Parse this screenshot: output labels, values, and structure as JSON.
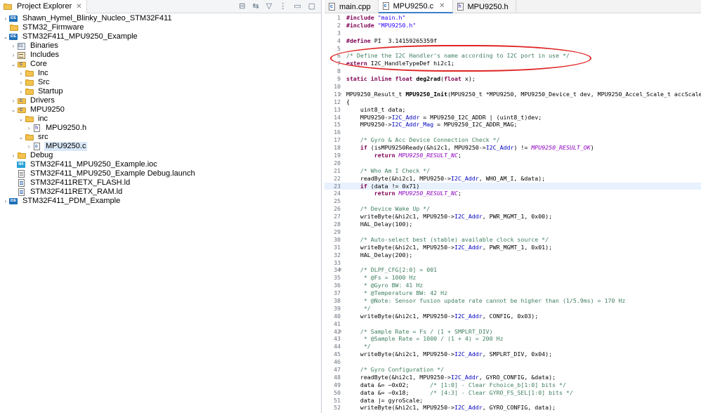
{
  "explorer": {
    "title": "Project Explorer",
    "tree": [
      {
        "label": "Shawn_Hymel_Blinky_Nucleo_STM32F411",
        "icon": "project-icon",
        "depth": 0,
        "caret": ">"
      },
      {
        "label": "STM32_Firmware",
        "icon": "folder-icon",
        "depth": 0,
        "caret": ""
      },
      {
        "label": "STM32F411_MPU9250_Example",
        "icon": "project-icon",
        "depth": 0,
        "caret": "v"
      },
      {
        "label": "Binaries",
        "icon": "binaries-icon",
        "depth": 1,
        "caret": ">"
      },
      {
        "label": "Includes",
        "icon": "includes-icon",
        "depth": 1,
        "caret": ">"
      },
      {
        "label": "Core",
        "icon": "source-folder-icon",
        "depth": 1,
        "caret": "v"
      },
      {
        "label": "Inc",
        "icon": "folder-icon",
        "depth": 2,
        "caret": ">"
      },
      {
        "label": "Src",
        "icon": "folder-icon",
        "depth": 2,
        "caret": ">"
      },
      {
        "label": "Startup",
        "icon": "folder-icon",
        "depth": 2,
        "caret": ">"
      },
      {
        "label": "Drivers",
        "icon": "source-folder-icon",
        "depth": 1,
        "caret": ">"
      },
      {
        "label": "MPU9250",
        "icon": "source-folder-icon",
        "depth": 1,
        "caret": "v"
      },
      {
        "label": "inc",
        "icon": "folder-icon",
        "depth": 2,
        "caret": "v"
      },
      {
        "label": "MPU9250.h",
        "icon": "header-file-icon",
        "depth": 3,
        "caret": ">"
      },
      {
        "label": "src",
        "icon": "folder-icon",
        "depth": 2,
        "caret": "v"
      },
      {
        "label": "MPU9250.c",
        "icon": "c-file-icon",
        "depth": 3,
        "caret": ">",
        "selected": true
      },
      {
        "label": "Debug",
        "icon": "folder-icon",
        "depth": 1,
        "caret": ">"
      },
      {
        "label": "STM32F411_MPU9250_Example.ioc",
        "icon": "ioc-file-icon",
        "depth": 1,
        "caret": ""
      },
      {
        "label": "STM32F411_MPU9250_Example Debug.launch",
        "icon": "launch-file-icon",
        "depth": 1,
        "caret": ""
      },
      {
        "label": "STM32F411RETX_FLASH.ld",
        "icon": "linker-file-icon",
        "depth": 1,
        "caret": ""
      },
      {
        "label": "STM32F411RETX_RAM.ld",
        "icon": "linker-file-icon",
        "depth": 1,
        "caret": ""
      },
      {
        "label": "STM32F411_PDM_Example",
        "icon": "project-icon",
        "depth": 0,
        "caret": ">"
      }
    ]
  },
  "editor": {
    "tabs": [
      {
        "label": "main.cpp",
        "icon": "cpp-file-icon",
        "active": false,
        "closable": false
      },
      {
        "label": "MPU9250.c",
        "icon": "c-file-icon",
        "active": true,
        "closable": true
      },
      {
        "label": "MPU9250.h",
        "icon": "header-file-icon",
        "active": false,
        "closable": false
      }
    ],
    "lines": [
      {
        "n": "1",
        "segs": [
          [
            "kw",
            "#include "
          ],
          [
            "str",
            "\"main.h\""
          ]
        ]
      },
      {
        "n": "2",
        "segs": [
          [
            "kw",
            "#include "
          ],
          [
            "str",
            "\"MPU9250.h\""
          ]
        ]
      },
      {
        "n": "3",
        "segs": []
      },
      {
        "n": "4",
        "segs": [
          [
            "kw",
            "#define "
          ],
          [
            "",
            "PI  3.14159265359f"
          ]
        ]
      },
      {
        "n": "5",
        "segs": []
      },
      {
        "n": "6",
        "segs": [
          [
            "cm",
            "/* Define the I2C Handler's name according to I2C port in use */"
          ]
        ]
      },
      {
        "n": "7",
        "segs": [
          [
            "kw",
            "extern "
          ],
          [
            "",
            "I2C_HandleTypeDef hi2c1;"
          ]
        ]
      },
      {
        "n": "8",
        "segs": []
      },
      {
        "n": "9",
        "segs": [
          [
            "kw",
            "static inline float "
          ],
          [
            "fn",
            "deg2rad"
          ],
          [
            "",
            "("
          ],
          [
            "kw",
            "float "
          ],
          [
            "",
            "x);"
          ]
        ]
      },
      {
        "n": "10",
        "segs": []
      },
      {
        "n": "11",
        "fold": "⊖",
        "segs": [
          [
            "",
            "MPU9250_Result_t "
          ],
          [
            "fn",
            "MPU9250_Init"
          ],
          [
            "",
            "(MPU9250_t *MPU9250, MPU9250_Device_t dev, MPU9250_Accel_Scale_t accScale"
          ]
        ]
      },
      {
        "n": "12",
        "segs": [
          [
            "",
            "{"
          ]
        ]
      },
      {
        "n": "13",
        "segs": [
          [
            "",
            "    uint8_t data;"
          ]
        ]
      },
      {
        "n": "14",
        "segs": [
          [
            "",
            "    MPU9250->"
          ],
          [
            "fld",
            "I2C_Addr"
          ],
          [
            "",
            " = MPU9250_I2C_ADDR | (uint8_t)dev;"
          ]
        ]
      },
      {
        "n": "15",
        "segs": [
          [
            "",
            "    MPU9250->"
          ],
          [
            "fld",
            "I2C_Addr_Mag"
          ],
          [
            "",
            " = MPU9250_I2C_ADDR_MAG;"
          ]
        ]
      },
      {
        "n": "16",
        "segs": []
      },
      {
        "n": "17",
        "segs": [
          [
            "cm",
            "    /* Gyro & Acc Device Connection Check */"
          ]
        ]
      },
      {
        "n": "18",
        "segs": [
          [
            "kw",
            "    if "
          ],
          [
            "",
            "(isMPU9250Ready(&hi2c1, MPU9250->"
          ],
          [
            "fld",
            "I2C_Addr"
          ],
          [
            "",
            ") != "
          ],
          [
            "mac",
            "MPU9250_RESULT_OK"
          ],
          [
            "",
            ")"
          ]
        ]
      },
      {
        "n": "19",
        "segs": [
          [
            "kw",
            "        return "
          ],
          [
            "mac",
            "MPU9250_RESULT_NC"
          ],
          [
            "",
            ";"
          ]
        ]
      },
      {
        "n": "20",
        "segs": []
      },
      {
        "n": "21",
        "segs": [
          [
            "cm",
            "    /* Who Am I Check */"
          ]
        ]
      },
      {
        "n": "22",
        "segs": [
          [
            "",
            "    readByte(&hi2c1, MPU9250->"
          ],
          [
            "fld",
            "I2C_Addr"
          ],
          [
            "",
            ", WHO_AM_I, &data);"
          ]
        ]
      },
      {
        "n": "23",
        "current": true,
        "segs": [
          [
            "kw",
            "    if "
          ],
          [
            "",
            "(data != 0x71)"
          ]
        ]
      },
      {
        "n": "24",
        "segs": [
          [
            "kw",
            "        return "
          ],
          [
            "mac",
            "MPU9250_RESULT_NC"
          ],
          [
            "",
            ";"
          ]
        ]
      },
      {
        "n": "25",
        "segs": []
      },
      {
        "n": "26",
        "segs": [
          [
            "cm",
            "    /* Device Wake Up */"
          ]
        ]
      },
      {
        "n": "27",
        "segs": [
          [
            "",
            "    writeByte(&hi2c1, MPU9250->"
          ],
          [
            "fld",
            "I2C_Addr"
          ],
          [
            "",
            ", PWR_MGMT_1, 0x00);"
          ]
        ]
      },
      {
        "n": "28",
        "segs": [
          [
            "",
            "    HAL_Delay(100);"
          ]
        ]
      },
      {
        "n": "29",
        "segs": []
      },
      {
        "n": "30",
        "segs": [
          [
            "cm",
            "    /* Auto-select best (stable) available clock source */"
          ]
        ]
      },
      {
        "n": "31",
        "segs": [
          [
            "",
            "    writeByte(&hi2c1, MPU9250->"
          ],
          [
            "fld",
            "I2C_Addr"
          ],
          [
            "",
            ", PWR_MGMT_1, 0x01);"
          ]
        ]
      },
      {
        "n": "32",
        "segs": [
          [
            "",
            "    HAL_Delay(200);"
          ]
        ]
      },
      {
        "n": "33",
        "segs": []
      },
      {
        "n": "34",
        "fold": "⊖",
        "segs": [
          [
            "cm",
            "    /* DLPF_CFG[2:0] = 001"
          ]
        ]
      },
      {
        "n": "35",
        "segs": [
          [
            "cm",
            "     * @Fs = 1000 Hz"
          ]
        ]
      },
      {
        "n": "36",
        "segs": [
          [
            "cm",
            "     * @Gyro BW: 41 Hz"
          ]
        ]
      },
      {
        "n": "37",
        "segs": [
          [
            "cm",
            "     * @Temperature BW: 42 Hz"
          ]
        ]
      },
      {
        "n": "38",
        "segs": [
          [
            "cm",
            "     * @Note: Sensor fusion update rate cannot be higher than (1/5.9ms) = 170 Hz"
          ]
        ]
      },
      {
        "n": "39",
        "segs": [
          [
            "cm",
            "     */"
          ]
        ]
      },
      {
        "n": "40",
        "segs": [
          [
            "",
            "    writeByte(&hi2c1, MPU9250->"
          ],
          [
            "fld",
            "I2C_Addr"
          ],
          [
            "",
            ", CONFIG, 0x03);"
          ]
        ]
      },
      {
        "n": "41",
        "segs": []
      },
      {
        "n": "42",
        "fold": "⊖",
        "segs": [
          [
            "cm",
            "    /* Sample Rate = Fs / (1 + SMPLRT_DIV)"
          ]
        ]
      },
      {
        "n": "43",
        "segs": [
          [
            "cm",
            "     * @Sample Rate = 1000 / (1 + 4) = 200 Hz"
          ]
        ]
      },
      {
        "n": "44",
        "segs": [
          [
            "cm",
            "     */"
          ]
        ]
      },
      {
        "n": "45",
        "segs": [
          [
            "",
            "    writeByte(&hi2c1, MPU9250->"
          ],
          [
            "fld",
            "I2C_Addr"
          ],
          [
            "",
            ", SMPLRT_DIV, 0x04);"
          ]
        ]
      },
      {
        "n": "46",
        "segs": []
      },
      {
        "n": "47",
        "segs": [
          [
            "cm",
            "    /* Gyro Configuration */"
          ]
        ]
      },
      {
        "n": "48",
        "segs": [
          [
            "",
            "    readByte(&hi2c1, MPU9250->"
          ],
          [
            "fld",
            "I2C_Addr"
          ],
          [
            "",
            ", GYRO_CONFIG, &data);"
          ]
        ]
      },
      {
        "n": "49",
        "segs": [
          [
            "",
            "    data &= ~0x02;      "
          ],
          [
            "cm",
            "/* [1:0] - Clear Fchoice_b[1:0] bits */"
          ]
        ]
      },
      {
        "n": "50",
        "segs": [
          [
            "",
            "    data &= ~0x18;      "
          ],
          [
            "cm",
            "/* [4:3] - Clear GYRO_FS_SEL[1:0] bits */"
          ]
        ]
      },
      {
        "n": "51",
        "segs": [
          [
            "",
            "    data |= gyroScale;"
          ]
        ]
      },
      {
        "n": "52",
        "segs": [
          [
            "",
            "    writeByte(&hi2c1, MPU9250->"
          ],
          [
            "fld",
            "I2C_Addr"
          ],
          [
            "",
            ", GYRO_CONFIG, data);"
          ]
        ]
      },
      {
        "n": "53",
        "segs": []
      }
    ]
  },
  "colors": {
    "annotation": "#e02424",
    "keyword": "#7f0055",
    "string": "#2a00ff",
    "comment": "#3f7f5f",
    "field": "#0000c0",
    "macro": "#8e00c0",
    "selection": "#d9e8f8",
    "accent": "#3c7fc5"
  }
}
